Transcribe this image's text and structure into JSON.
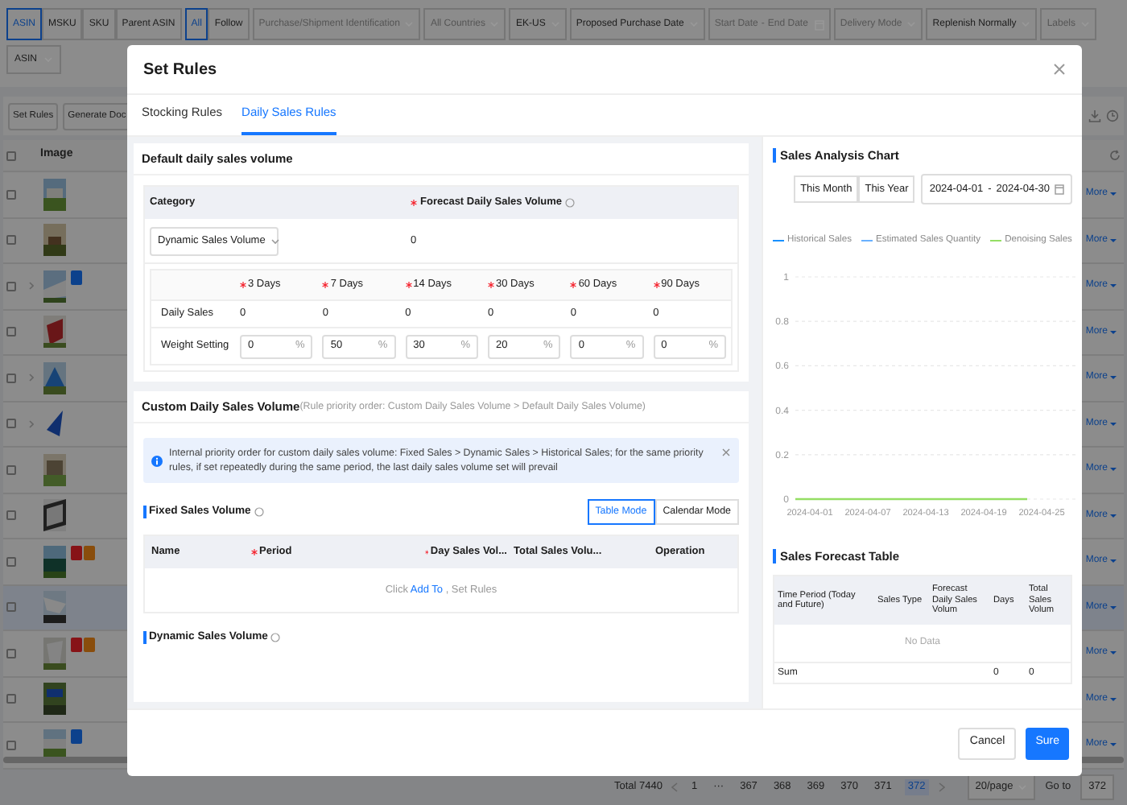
{
  "filters": {
    "id_types": [
      {
        "label": "ASIN",
        "selected": true
      },
      {
        "label": "MSKU",
        "selected": false
      },
      {
        "label": "SKU",
        "selected": false
      },
      {
        "label": "Parent ASIN",
        "selected": false
      }
    ],
    "follow_types": [
      {
        "label": "All",
        "selected": true
      },
      {
        "label": "Follow",
        "selected": false
      }
    ],
    "dropdowns": [
      {
        "kind": "placeholder",
        "text": "Purchase/Shipment Identification"
      },
      {
        "kind": "placeholder",
        "text": "All Countries"
      },
      {
        "kind": "value",
        "text": "EK-US"
      },
      {
        "kind": "value",
        "text": "Proposed Purchase Date"
      },
      {
        "kind": "daterange",
        "start": "Start Date",
        "separator": "-",
        "end": "End Date"
      },
      {
        "kind": "placeholder",
        "text": "Delivery Mode"
      },
      {
        "kind": "value",
        "text": "Replenish Normally"
      },
      {
        "kind": "placeholder",
        "text": "Labels"
      }
    ],
    "search_type": "ASIN"
  },
  "toolbar": {
    "buttons": [
      "Set Rules",
      "Generate Doc"
    ]
  },
  "table": {
    "select_all_checked": false,
    "columns": [
      "Image"
    ],
    "rows": [
      {
        "selected": false,
        "expandable": false,
        "badges": [],
        "more": "More"
      },
      {
        "selected": false,
        "expandable": false,
        "badges": [],
        "more": "More"
      },
      {
        "selected": false,
        "expandable": true,
        "badges": [
          {
            "color": "#0c418c"
          }
        ],
        "more": "More"
      },
      {
        "selected": false,
        "expandable": false,
        "badges": [],
        "more": "More"
      },
      {
        "selected": false,
        "expandable": true,
        "badges": [],
        "more": "More"
      },
      {
        "selected": false,
        "expandable": true,
        "badges": [],
        "more": "More"
      },
      {
        "selected": false,
        "expandable": false,
        "badges": [],
        "more": "More"
      },
      {
        "selected": false,
        "expandable": false,
        "badges": [],
        "more": "More"
      },
      {
        "selected": false,
        "expandable": false,
        "badges": [
          {
            "color": "#871317"
          },
          {
            "color": "#894d0c"
          }
        ],
        "more": "More"
      },
      {
        "selected": true,
        "expandable": false,
        "badges": [],
        "more": "More"
      },
      {
        "selected": false,
        "expandable": false,
        "badges": [
          {
            "color": "#871317"
          },
          {
            "color": "#894d0c"
          }
        ],
        "more": "More"
      },
      {
        "selected": false,
        "expandable": false,
        "badges": [],
        "more": "More"
      },
      {
        "selected": false,
        "expandable": false,
        "badges": [
          {
            "color": "#0c418c"
          }
        ],
        "more": "More"
      }
    ]
  },
  "pagination": {
    "total": "Total 7440",
    "pages": [
      {
        "label": "1",
        "selected": false
      },
      {
        "label": "···",
        "selected": false
      },
      {
        "label": "367",
        "selected": false
      },
      {
        "label": "368",
        "selected": false
      },
      {
        "label": "369",
        "selected": false
      },
      {
        "label": "370",
        "selected": false
      },
      {
        "label": "371",
        "selected": false
      },
      {
        "label": "372",
        "selected": true
      }
    ],
    "page_size": "20/page",
    "goto_label": "Go to",
    "goto_value": "372"
  },
  "modal": {
    "title": "Set Rules",
    "tabs": [
      {
        "label": "Stocking Rules",
        "selected": false
      },
      {
        "label": "Daily Sales Rules",
        "selected": true
      }
    ],
    "default_section": {
      "title": "Default daily sales volume",
      "category_label": "Category",
      "forecast_label": "Forecast Daily Sales Volume",
      "category_value": "Dynamic Sales Volume",
      "forecast_value": "0",
      "row_labels": [
        "Daily Sales",
        "Weight Setting"
      ],
      "periods": [
        {
          "label": "3 Days",
          "daily_sales": "0",
          "weight": "0",
          "unit": "%"
        },
        {
          "label": "7 Days",
          "daily_sales": "0",
          "weight": "50",
          "unit": "%"
        },
        {
          "label": "14 Days",
          "daily_sales": "0",
          "weight": "30",
          "unit": "%"
        },
        {
          "label": "30 Days",
          "daily_sales": "0",
          "weight": "20",
          "unit": "%"
        },
        {
          "label": "60 Days",
          "daily_sales": "0",
          "weight": "0",
          "unit": "%"
        },
        {
          "label": "90 Days",
          "daily_sales": "0",
          "weight": "0",
          "unit": "%"
        }
      ]
    },
    "custom_section": {
      "title": "Custom Daily Sales Volume",
      "note": "(Rule priority order: Custom Daily Sales Volume > Default Daily Sales Volume)",
      "alert": "Internal priority order for custom daily sales volume: Fixed Sales > Dynamic Sales > Historical Sales; for the same priority rules, if set repeatedly during the same period, the last daily sales volume set will prevail",
      "fixed": {
        "title": "Fixed Sales Volume",
        "modes": [
          {
            "label": "Table Mode",
            "selected": true
          },
          {
            "label": "Calendar Mode",
            "selected": false
          }
        ],
        "columns": [
          {
            "label": "Name",
            "required": false
          },
          {
            "label": "Period",
            "required": true
          },
          {
            "label": "Day Sales Vol...",
            "required": true
          },
          {
            "label": "Total Sales Volu...",
            "required": false
          },
          {
            "label": "Operation",
            "required": false
          }
        ],
        "empty": {
          "before": "Click",
          "link": "Add To",
          "after": ", Set Rules"
        }
      },
      "dynamic_title": "Dynamic Sales Volume"
    },
    "chart": {
      "title": "Sales Analysis Chart",
      "range_buttons": [
        {
          "label": "This Month",
          "selected": false
        },
        {
          "label": "This Year",
          "selected": false
        }
      ],
      "date_start": "2024-04-01",
      "date_separator": "-",
      "date_end": "2024-04-30",
      "chart_data": {
        "type": "line",
        "categories": [
          "2024-04-01",
          "2024-04-07",
          "2024-04-13",
          "2024-04-19",
          "2024-04-25"
        ],
        "series": [
          {
            "name": "Historical Sales",
            "color": "#1890ff",
            "values": [
              null,
              null,
              null,
              null,
              null
            ]
          },
          {
            "name": "Estimated Sales Quantity",
            "color": "#69b1ff",
            "values": [
              null,
              null,
              null,
              null,
              null
            ]
          },
          {
            "name": "Denoising Sales",
            "color": "#95de64",
            "values": [
              0,
              0,
              0,
              0,
              0
            ]
          }
        ],
        "ylim": [
          0,
          1
        ],
        "yticks": [
          0,
          0.2,
          0.4,
          0.6,
          0.8,
          1
        ],
        "grid": true
      }
    },
    "forecast_table": {
      "title": "Sales Forecast Table",
      "columns": [
        "Time Period (Today and Future)",
        "Sales Type",
        "Forecast Daily Sales Volum",
        "Days",
        "Total Sales Volum"
      ],
      "empty": "No Data",
      "sum": {
        "label": "Sum",
        "days": "0",
        "total": "0"
      }
    },
    "buttons": [
      {
        "label": "Cancel",
        "kind": "secondary"
      },
      {
        "label": "Sure",
        "kind": "primary"
      }
    ]
  }
}
